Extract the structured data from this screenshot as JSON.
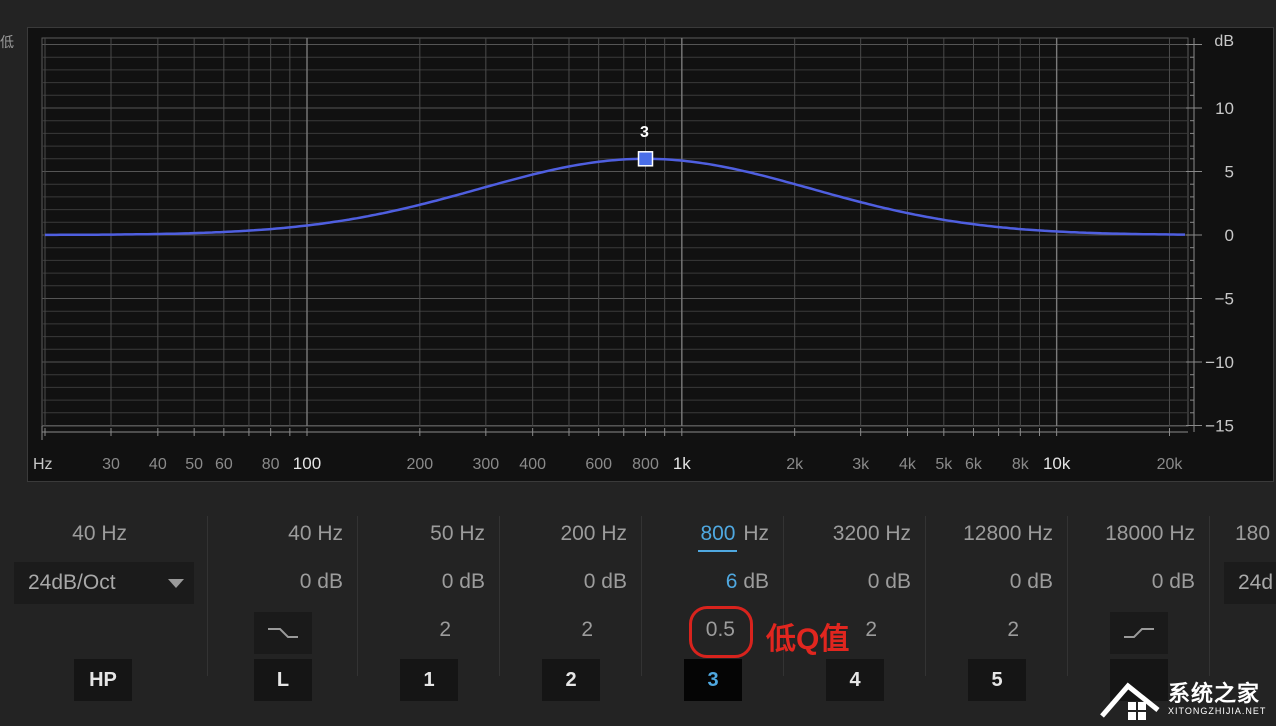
{
  "edge_glyph": "低",
  "graph": {
    "db_unit": "dB",
    "db_labels": [
      {
        "db": 10,
        "label": "10"
      },
      {
        "db": 5,
        "label": "5"
      },
      {
        "db": 0,
        "label": "0"
      },
      {
        "db": -5,
        "label": "−5"
      },
      {
        "db": -10,
        "label": "−10"
      },
      {
        "db": -15,
        "label": "−15"
      }
    ],
    "freq_unit": "Hz",
    "freq_labels": [
      {
        "f": 30,
        "label": "30",
        "major": false
      },
      {
        "f": 40,
        "label": "40",
        "major": false
      },
      {
        "f": 50,
        "label": "50",
        "major": false
      },
      {
        "f": 60,
        "label": "60",
        "major": false
      },
      {
        "f": 80,
        "label": "80",
        "major": false
      },
      {
        "f": 100,
        "label": "100",
        "major": true
      },
      {
        "f": 200,
        "label": "200",
        "major": false
      },
      {
        "f": 300,
        "label": "300",
        "major": false
      },
      {
        "f": 400,
        "label": "400",
        "major": false
      },
      {
        "f": 600,
        "label": "600",
        "major": false
      },
      {
        "f": 800,
        "label": "800",
        "major": false
      },
      {
        "f": 1000,
        "label": "1k",
        "major": true
      },
      {
        "f": 2000,
        "label": "2k",
        "major": false
      },
      {
        "f": 3000,
        "label": "3k",
        "major": false
      },
      {
        "f": 4000,
        "label": "4k",
        "major": false
      },
      {
        "f": 5000,
        "label": "5k",
        "major": false
      },
      {
        "f": 6000,
        "label": "6k",
        "major": false
      },
      {
        "f": 8000,
        "label": "8k",
        "major": false
      },
      {
        "f": 10000,
        "label": "10k",
        "major": true
      },
      {
        "f": 20000,
        "label": "20k",
        "major": false
      }
    ],
    "active_band": {
      "label": "3",
      "freq": 800,
      "gain": 6,
      "q": 0.5
    },
    "colors": {
      "curve": "#4f5fe0",
      "node": "#4a6ee8",
      "grid": "#4a4a4a",
      "grid_major": "#7a7a7a"
    }
  },
  "hp": {
    "freq": "40 Hz",
    "slope": "24dB/Oct",
    "button": "HP"
  },
  "bands": [
    {
      "id": "L",
      "freq": "40 Hz",
      "gain": "0 dB",
      "q": "",
      "shape": "low-shelf-icon",
      "button": "L"
    },
    {
      "id": "1",
      "freq": "50 Hz",
      "gain": "0 dB",
      "q": "2",
      "button": "1"
    },
    {
      "id": "2",
      "freq": "200 Hz",
      "gain": "0 dB",
      "q": "2",
      "button": "2"
    },
    {
      "id": "3",
      "freq_value": "800",
      "freq_unit": "Hz",
      "gain_value": "6",
      "gain_unit": "dB",
      "q": "0.5",
      "button": "3"
    },
    {
      "id": "4",
      "freq": "3200 Hz",
      "gain": "0 dB",
      "q": "2",
      "button": "4"
    },
    {
      "id": "5",
      "freq": "12800 Hz",
      "gain": "0 dB",
      "q": "2",
      "button": "5"
    },
    {
      "id": "H",
      "freq": "18000 Hz",
      "gain": "0 dB",
      "q": "",
      "shape": "high-shelf-icon"
    }
  ],
  "lp": {
    "freq_partial": "180",
    "slope_partial": "24d"
  },
  "annotation": {
    "text": "低Q值"
  },
  "watermark": {
    "title": "系统之家",
    "url": "XITONGZHIJIA.NET"
  }
}
